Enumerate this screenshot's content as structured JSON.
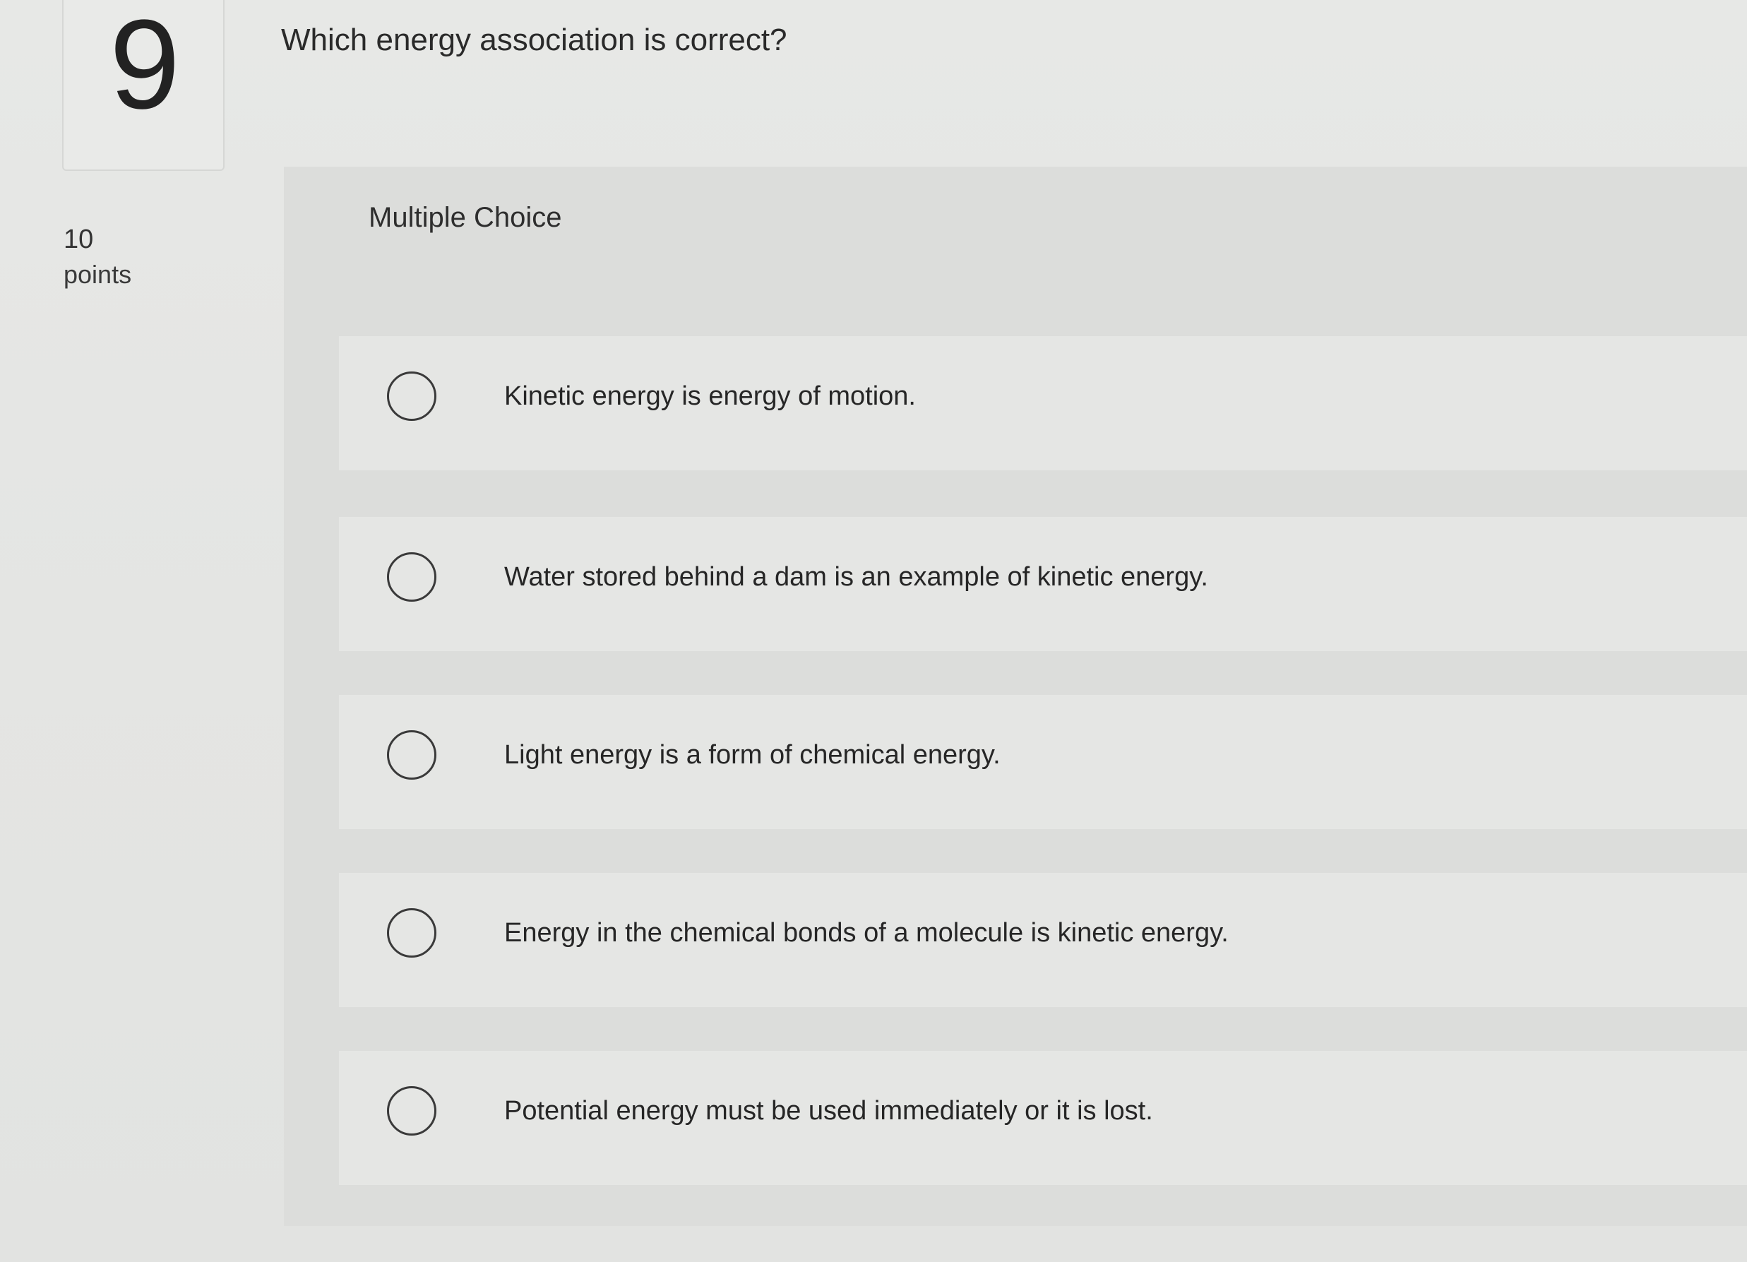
{
  "question": {
    "number": "9",
    "points_value": "10",
    "points_label": "points",
    "text": "Which energy association is correct?"
  },
  "question_type": "Multiple Choice",
  "options": [
    {
      "label": "Kinetic energy is energy of motion."
    },
    {
      "label": "Water stored behind a dam is an example of kinetic energy."
    },
    {
      "label": "Light energy is a form of chemical energy."
    },
    {
      "label": "Energy in the chemical bonds of a molecule is kinetic energy."
    },
    {
      "label": "Potential energy must be used immediately or it is lost."
    }
  ],
  "colors": {
    "background": "#e5e6e4",
    "panel": "#dcdddb",
    "text": "#2b2b2b"
  }
}
